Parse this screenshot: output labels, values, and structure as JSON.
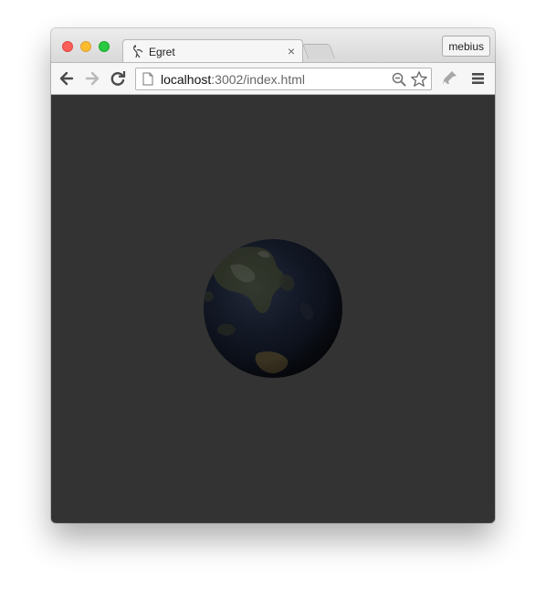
{
  "browser": {
    "tab": {
      "title": "Egret",
      "close_glyph": "×",
      "favicon": "egret-favicon-icon"
    },
    "profile_button": {
      "label": "mebius"
    },
    "address_bar": {
      "host": "localhost",
      "path": ":3002/index.html"
    },
    "toolbar_icons": [
      "back-arrow-icon",
      "forward-arrow-icon",
      "reload-icon",
      "zoom-icon",
      "bookmark-star-icon",
      "extension-icon",
      "menu-icon"
    ]
  },
  "page": {
    "background_color": "#333333",
    "content": "rotating-globe"
  },
  "colors": {
    "traffic_red": "#fc5f57",
    "traffic_yellow": "#fdbc2e",
    "traffic_green": "#28c840",
    "viewport_bg": "#333333"
  }
}
